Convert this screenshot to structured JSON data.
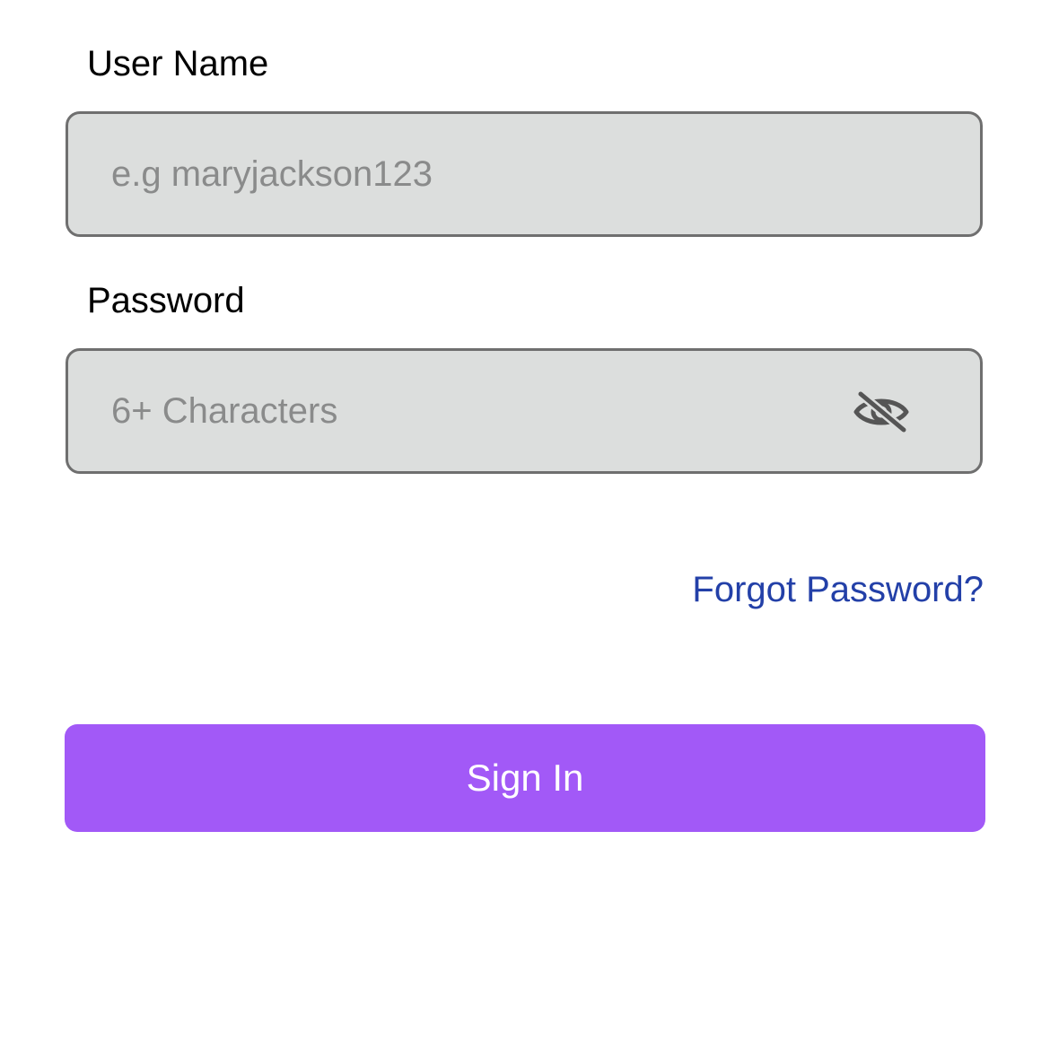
{
  "username": {
    "label": "User Name",
    "placeholder": "e.g maryjackson123",
    "value": ""
  },
  "password": {
    "label": "Password",
    "placeholder": "6+ Characters",
    "value": "",
    "toggle_icon": "eye-off-icon"
  },
  "forgot_password": {
    "label": "Forgot Password?"
  },
  "sign_in": {
    "label": "Sign In"
  },
  "colors": {
    "accent": "#a259f7",
    "link": "#2340a8",
    "input_bg": "#dcdedd",
    "input_border": "#6f6f6f"
  }
}
